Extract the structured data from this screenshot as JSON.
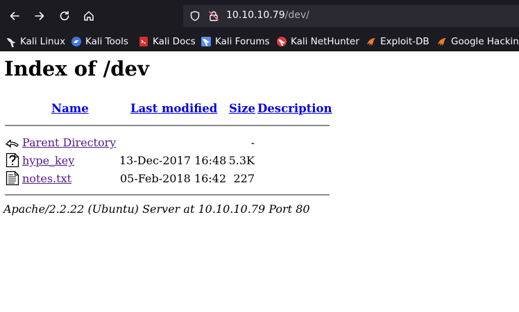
{
  "browser": {
    "url_host": "10.10.10.79",
    "url_path": "/dev/"
  },
  "bookmarks": [
    {
      "label": "Kali Linux",
      "icon": "kali-dragon-icon"
    },
    {
      "label": "Kali Tools",
      "icon": "kali-tools-icon"
    },
    {
      "label": "Kali Docs",
      "icon": "kali-docs-icon"
    },
    {
      "label": "Kali Forums",
      "icon": "kali-forums-icon"
    },
    {
      "label": "Kali NetHunter",
      "icon": "kali-nethunter-icon"
    },
    {
      "label": "Exploit-DB",
      "icon": "exploit-db-icon"
    },
    {
      "label": "Google Hacking",
      "icon": "google-hacking-icon"
    }
  ],
  "page": {
    "title": "Index of /dev",
    "columns": {
      "name": "Name",
      "last_modified": "Last modified",
      "size": "Size",
      "description": "Description"
    },
    "rows": [
      {
        "name": "Parent Directory",
        "modified": "",
        "size": "-",
        "icon": "back-arrow-icon"
      },
      {
        "name": "hype_key",
        "modified": "13-Dec-2017 16:48",
        "size": "5.3K",
        "icon": "unknown-file-icon"
      },
      {
        "name": "notes.txt",
        "modified": "05-Feb-2018 16:42",
        "size": "227",
        "icon": "text-file-icon"
      }
    ],
    "footer": "Apache/2.2.22 (Ubuntu) Server at 10.10.10.79 Port 80"
  },
  "colors": {
    "chrome_bg": "#1c1b22",
    "urlbar_bg": "#2b2a33",
    "link": "#0000ee",
    "visited_link": "#551a8b"
  }
}
